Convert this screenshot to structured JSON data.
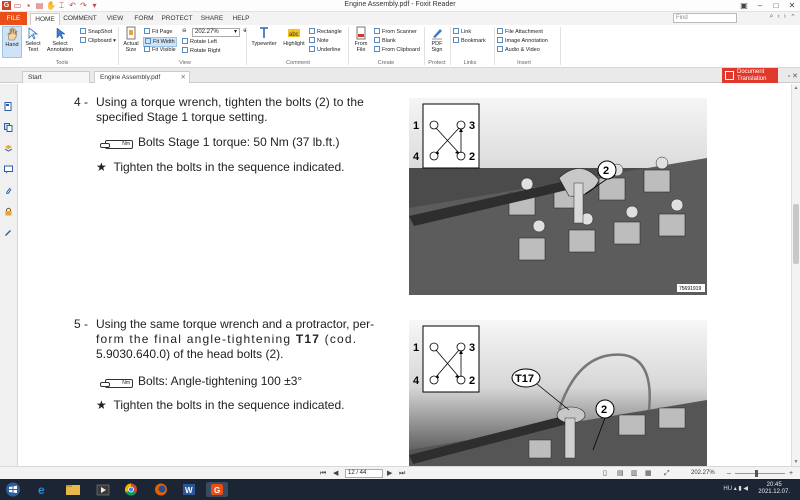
{
  "window": {
    "title": "Engine Assembly.pdf - Foxit Reader"
  },
  "ribbon_tabs": [
    "FILE",
    "HOME",
    "COMMENT",
    "VIEW",
    "FORM",
    "PROTECT",
    "SHARE",
    "HELP"
  ],
  "search": {
    "placeholder": "Find"
  },
  "ribbon": {
    "tools": {
      "hand": "Hand",
      "select_text": "Select Text",
      "select_annotation": "Select Annotation",
      "snapshot": "SnapShot",
      "clipboard": "Clipboard",
      "label": "Tools"
    },
    "view": {
      "actual_size": "Actual Size",
      "fit_page": "Fit Page",
      "fit_width": "Fit Width",
      "fit_visible": "Fit Visible",
      "zoom": "202.27%",
      "rotate_left": "Rotate Left",
      "rotate_right": "Rotate Right",
      "label": "View"
    },
    "comment": {
      "typewriter": "Typewriter",
      "highlight": "Highlight",
      "rectangle": "Rectangle",
      "note": "Note",
      "underline": "Underline",
      "label": "Comment"
    },
    "create": {
      "from_file": "From File",
      "from_scanner": "From Scanner",
      "blank": "Blank",
      "from_clipboard": "From Clipboard",
      "label": "Create"
    },
    "protect": {
      "pdf_sign": "PDF Sign",
      "label": "Protect"
    },
    "links": {
      "link": "Link",
      "bookmark": "Bookmark",
      "label": "Links"
    },
    "insert": {
      "file_attachment": "File Attachment",
      "image_annotation": "Image Annotation",
      "audio_video": "Audio & Video",
      "label": "Insert"
    }
  },
  "doc_tabs": [
    "Start",
    "Engine Assembly.pdf"
  ],
  "document_translation": "Document Translation",
  "content": {
    "step4": {
      "num": "4 -",
      "line1": "Using a torque wrench, tighten the bolts (2) to the",
      "line2": "specified Stage 1 torque setting.",
      "badge": "Nm",
      "spec": "Bolts Stage 1 torque: 50 Nm (37 lb.ft.)",
      "star": "★",
      "bullet": "Tighten the bolts in the sequence indicated.",
      "photo_code": "75691919"
    },
    "step5": {
      "num": "5 -",
      "line1": "Using the same torque wrench and a protractor, per-",
      "line2a": "form the final angle-tightening ",
      "line2b": "T17",
      "line2c": " (cod.",
      "line3": "5.9030.640.0) of the head bolts (2).",
      "badge": "Nm",
      "spec": "Bolts: Angle-tightening 100 ±3°",
      "star": "★",
      "bullet": "Tighten the bolts in the sequence indicated."
    },
    "diagram_labels": {
      "one": "1",
      "two": "2",
      "three": "3",
      "four": "4",
      "callout_bolt": "2",
      "callout_tool": "T17"
    }
  },
  "status": {
    "page": "12 / 44",
    "zoom": "202.27%"
  },
  "taskbar": {
    "tray_lang": "HU",
    "time": "20:45",
    "date": "2021.12.07."
  },
  "colors": {
    "accent": "#e94f17",
    "translate": "#e0392b",
    "taskbar": "#1c2533"
  }
}
